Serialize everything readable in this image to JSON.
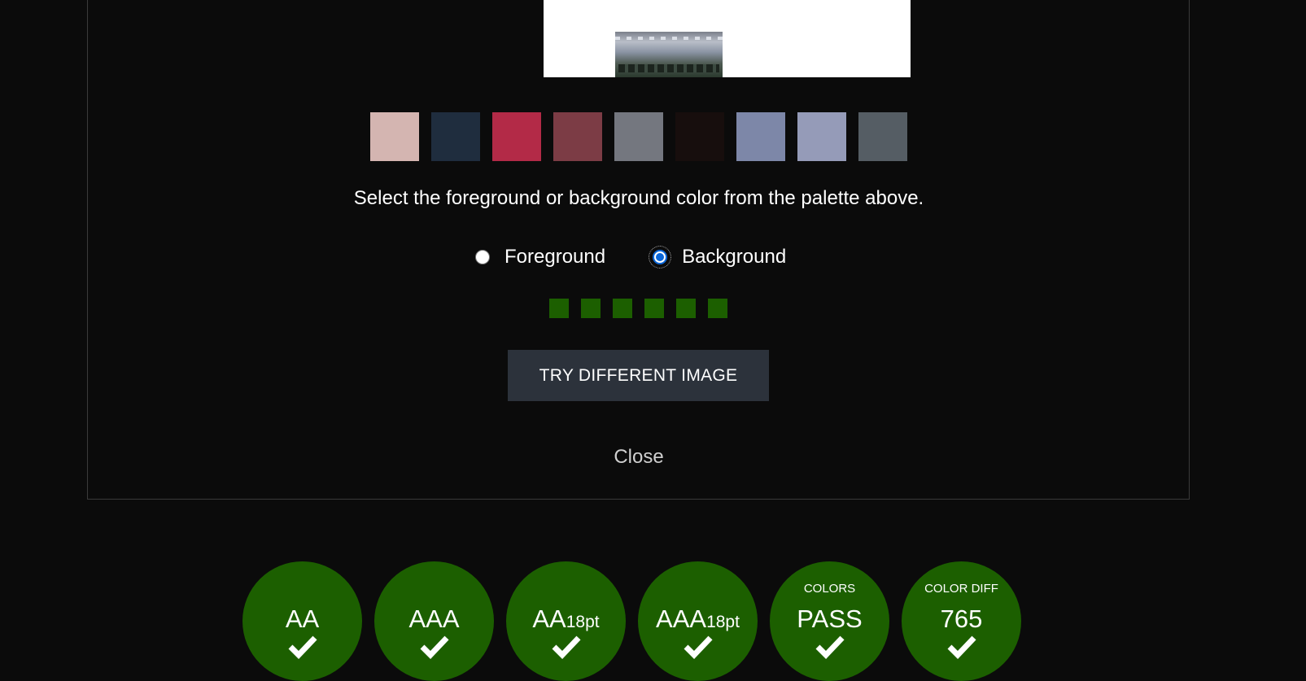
{
  "palette": {
    "swatches": [
      "#d4b5b1",
      "#1f2d3e",
      "#b32a47",
      "#7c3c45",
      "#74777f",
      "#170e0d",
      "#7d87a8",
      "#959bb8",
      "#555d64"
    ]
  },
  "instruction": "Select the foreground or background color from the palette above.",
  "radios": {
    "foreground_label": "Foreground",
    "background_label": "Background",
    "selected": "background"
  },
  "progress_dots": {
    "count": 6,
    "color": "#1c5f00"
  },
  "try_button_label": "TRY DIFFERENT IMAGE",
  "close_label": "Close",
  "results": [
    {
      "top": "",
      "main": "AA",
      "sub": "",
      "status": "pass"
    },
    {
      "top": "",
      "main": "AAA",
      "sub": "",
      "status": "pass"
    },
    {
      "top": "",
      "main": "AA",
      "sub": "18pt",
      "status": "pass"
    },
    {
      "top": "",
      "main": "AAA",
      "sub": "18pt",
      "status": "pass"
    },
    {
      "top": "COLORS",
      "main": "PASS",
      "sub": "",
      "status": "pass"
    },
    {
      "top": "COLOR DIFF",
      "main": "765",
      "sub": "",
      "status": "pass"
    }
  ],
  "colors": {
    "pass_green": "#1c5f00",
    "button_bg": "#2c323b",
    "page_bg": "#0b0b0b"
  }
}
